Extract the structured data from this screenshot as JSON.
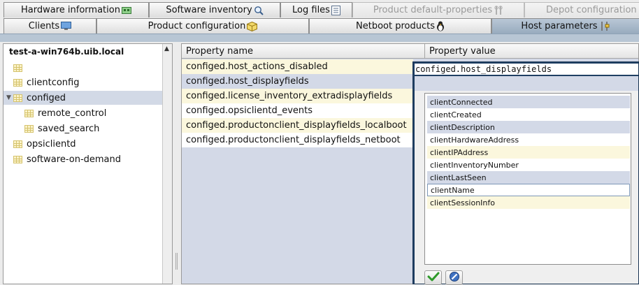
{
  "tabs_row1": [
    {
      "label": "Hardware information",
      "icon": "hardware-icon",
      "disabled": false
    },
    {
      "label": "Software inventory",
      "icon": "magnifier-icon",
      "disabled": false
    },
    {
      "label": "Log files",
      "icon": "logfile-icon",
      "disabled": false
    },
    {
      "label": "Product default-properties",
      "icon": "tools-icon",
      "disabled": true
    },
    {
      "label": "Depot configuration",
      "icon": "depot-icon",
      "disabled": true
    }
  ],
  "tabs_row2": [
    {
      "label": "Clients",
      "icon": "monitor-icon",
      "active": false
    },
    {
      "label": "Product configuration",
      "icon": "package-icon",
      "active": false
    },
    {
      "label": "Netboot products",
      "icon": "linux-penguin-icon",
      "active": false
    },
    {
      "label": "Host parameters",
      "icon": "host-parameters-icon",
      "active": true
    }
  ],
  "tree": {
    "root": "test-a-win764b.uib.local",
    "nodes": [
      {
        "label": ""
      },
      {
        "label": "clientconfig"
      },
      {
        "label": "configed",
        "expanded": true,
        "selected": true
      },
      {
        "label": "remote_control"
      },
      {
        "label": "saved_search"
      },
      {
        "label": "opsiclientd"
      },
      {
        "label": "software-on-demand"
      }
    ]
  },
  "table": {
    "col_name": "Property name",
    "col_value": "Property value",
    "rows": [
      "configed.host_actions_disabled",
      "configed.host_displayfields",
      "configed.license_inventory_extradisplayfields",
      "configed.opsiclientd_events",
      "configed.productonclient_displayfields_localboot",
      "configed.productonclient_displayfields_netboot"
    ]
  },
  "editor": {
    "title": "configed.host_displayfields",
    "values": [
      "clientConnected",
      "clientCreated",
      "clientDescription",
      "clientHardwareAddress",
      "clientIPAddress",
      "clientInventoryNumber",
      "clientLastSeen",
      "clientName",
      "clientSessionInfo"
    ],
    "ok_icon": "checkmark-icon",
    "cancel_icon": "cancel-icon"
  },
  "colors": {
    "row_yellow": "#fbf7dd",
    "row_white": "#ffffff",
    "row_blue": "#d3d9e7",
    "editor_border": "#1f3f63",
    "active_tab": "#a6b7c9"
  }
}
